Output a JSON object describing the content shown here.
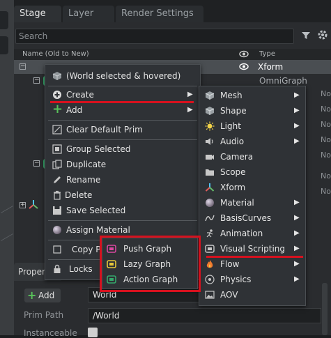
{
  "tabs": {
    "stage": "Stage",
    "layer": "Layer",
    "render": "Render Settings"
  },
  "search": {
    "placeholder": "Search"
  },
  "columns": {
    "name": "Name (Old to New)",
    "type": "Type"
  },
  "tree": {
    "rows": [
      {
        "type": "Xform"
      },
      {
        "type": "OmniGraph"
      }
    ],
    "node_label": "Nod"
  },
  "context_menu": {
    "header": "(World selected & hovered)",
    "items": [
      {
        "id": "create",
        "label": "Create"
      },
      {
        "id": "add",
        "label": "Add"
      },
      {
        "id": "clear-default-prim",
        "label": "Clear Default Prim"
      },
      {
        "id": "group-selected",
        "label": "Group Selected"
      },
      {
        "id": "duplicate",
        "label": "Duplicate"
      },
      {
        "id": "rename",
        "label": "Rename"
      },
      {
        "id": "delete",
        "label": "Delete"
      },
      {
        "id": "save-selected",
        "label": "Save Selected"
      },
      {
        "id": "assign-material",
        "label": "Assign Material"
      },
      {
        "id": "copy-prim-path",
        "label": "Copy P"
      },
      {
        "id": "locks",
        "label": "Locks"
      }
    ]
  },
  "create_menu": {
    "items": [
      {
        "id": "mesh",
        "label": "Mesh"
      },
      {
        "id": "shape",
        "label": "Shape"
      },
      {
        "id": "light",
        "label": "Light"
      },
      {
        "id": "audio",
        "label": "Audio"
      },
      {
        "id": "camera",
        "label": "Camera"
      },
      {
        "id": "scope",
        "label": "Scope"
      },
      {
        "id": "xform",
        "label": "Xform"
      },
      {
        "id": "material",
        "label": "Material"
      },
      {
        "id": "basis-curves",
        "label": "BasisCurves"
      },
      {
        "id": "animation",
        "label": "Animation"
      },
      {
        "id": "visual-scripting",
        "label": "Visual Scripting"
      },
      {
        "id": "flow",
        "label": "Flow"
      },
      {
        "id": "physics",
        "label": "Physics"
      },
      {
        "id": "aov",
        "label": "AOV"
      }
    ]
  },
  "graph_menu": {
    "items": [
      {
        "id": "push-graph",
        "label": "Push Graph"
      },
      {
        "id": "lazy-graph",
        "label": "Lazy Graph"
      },
      {
        "id": "action-graph",
        "label": "Action Graph"
      }
    ]
  },
  "property": {
    "tab": "Proper",
    "add_label": "Add",
    "name_value": "World",
    "prim_path_label": "Prim Path",
    "prim_path_value": "/World",
    "instanceable_label": "Instanceable"
  },
  "colors": {
    "highlight_red": "#d6111e",
    "omnigraph_green": "#35a86b"
  }
}
